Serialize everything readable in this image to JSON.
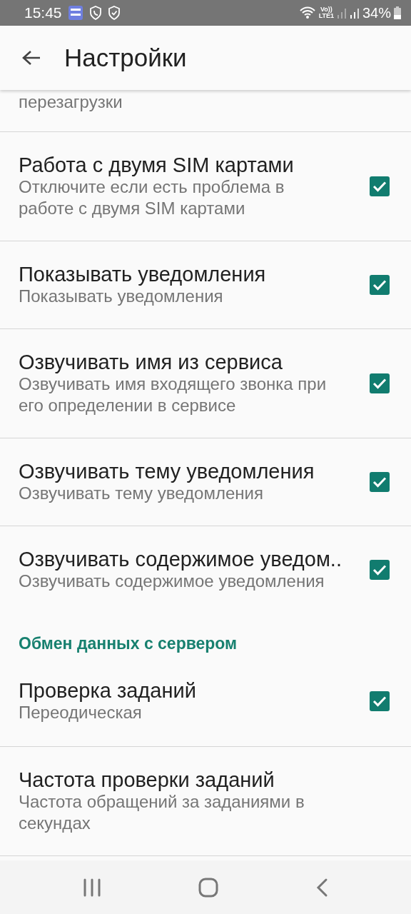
{
  "status_bar": {
    "time": "15:45",
    "volte": "Vo))",
    "network": "LTE1",
    "battery": "34%"
  },
  "toolbar": {
    "title": "Настройки"
  },
  "preferences": [
    {
      "kind": "fragment",
      "summary": "перезагрузки"
    },
    {
      "kind": "checkbox",
      "title": "Работа с двумя SIM картами",
      "summary": "Отключите если есть проблема в работе с двумя SIM картами",
      "checked": true
    },
    {
      "kind": "checkbox",
      "title": "Показывать уведомления",
      "summary": "Показывать уведомления",
      "checked": true
    },
    {
      "kind": "checkbox",
      "title": "Озвучивать имя из сервиса",
      "summary": "Озвучивать имя входящего звонка при его определении в сервисе",
      "checked": true
    },
    {
      "kind": "checkbox",
      "title": "Озвучивать тему уведомления",
      "summary": "Озвучивать тему уведомления",
      "checked": true
    },
    {
      "kind": "checkbox",
      "title": "Озвучивать содержимое уведом..",
      "summary": "Озвучивать содержимое уведомления",
      "checked": true
    },
    {
      "kind": "category",
      "title": "Обмен данных с сервером"
    },
    {
      "kind": "checkbox",
      "title": "Проверка заданий",
      "summary": "Переодическая",
      "checked": true
    },
    {
      "kind": "plain",
      "title": "Частота проверки заданий",
      "summary": "Частота обращений за заданиями в секундах"
    }
  ]
}
